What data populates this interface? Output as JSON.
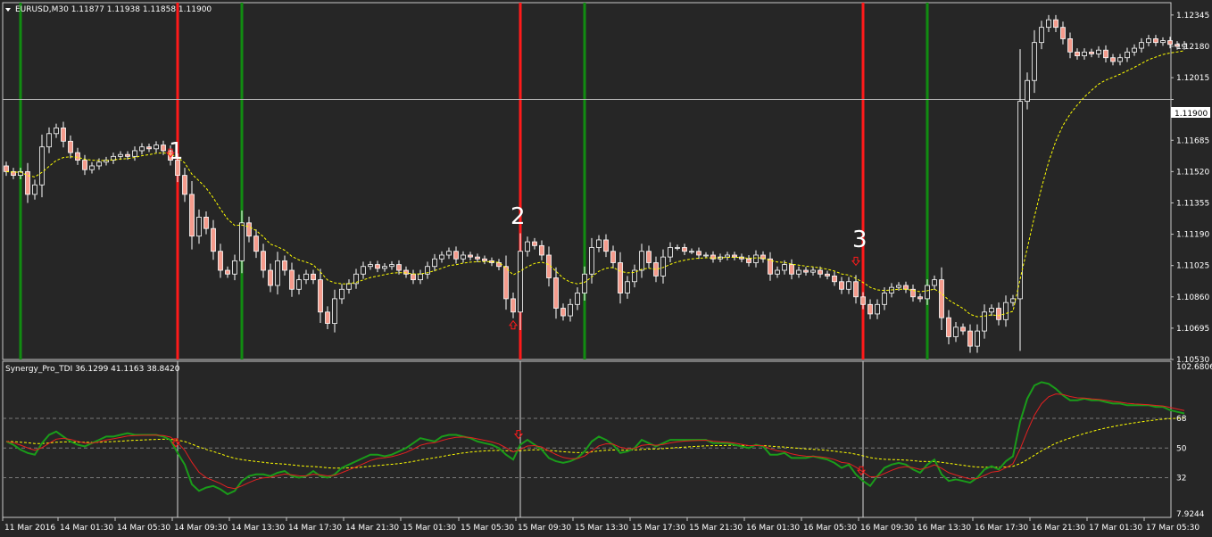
{
  "main_panel": {
    "symbol_header": "EURUSD,M30  1.11877 1.11938 1.11858 1.11900",
    "current_price_label": "1.11900",
    "annotations": [
      "1",
      "2",
      "3"
    ]
  },
  "indicator_panel": {
    "header": "Synergy_Pro_TDI 36.1299 41.1163 38.8420"
  },
  "colors": {
    "background": "#262626",
    "frame": "#c8c8c8",
    "bull_candle": "#ffffff",
    "bear_candle": "#f59b8c",
    "ma": "#ffff00",
    "signal_sell": "#ff1a1a",
    "signal_buy": "#118c11",
    "tdi_green": "#1a9c1a",
    "tdi_red": "#e52020",
    "tdi_yellow": "#ffff00"
  },
  "chart_data": [
    {
      "type": "candlestick",
      "title": "EURUSD,M30",
      "ohlc_header": {
        "open": 1.11877,
        "high": 1.11938,
        "low": 1.11858,
        "close": 1.119
      },
      "ylim": [
        1.1053,
        1.1241
      ],
      "y_ticks": [
        "1.12345",
        "1.12180",
        "1.12015",
        "1.11900",
        "1.11685",
        "1.11520",
        "1.11355",
        "1.11190",
        "1.11025",
        "1.10860",
        "1.10695",
        "1.10530"
      ],
      "y_tick_values": [
        1.12345,
        1.1218,
        1.12015,
        1.119,
        1.11685,
        1.1152,
        1.11355,
        1.1119,
        1.11025,
        1.1086,
        1.10695,
        1.1053
      ],
      "current_price": 1.119,
      "x_ticks": [
        "11 Mar 2016",
        "14 Mar 01:30",
        "14 Mar 05:30",
        "14 Mar 09:30",
        "14 Mar 13:30",
        "14 Mar 17:30",
        "14 Mar 21:30",
        "15 Mar 01:30",
        "15 Mar 05:30",
        "15 Mar 09:30",
        "15 Mar 13:30",
        "15 Mar 17:30",
        "15 Mar 21:30",
        "16 Mar 01:30",
        "16 Mar 05:30",
        "16 Mar 09:30",
        "16 Mar 13:30",
        "16 Mar 17:30",
        "16 Mar 21:30",
        "17 Mar 01:30",
        "17 Mar 05:30"
      ],
      "sell_signal_bars": [
        24,
        72,
        120
      ],
      "buy_signal_bars": [
        2,
        33,
        81,
        129
      ],
      "annotations": [
        {
          "text": "1",
          "bar": 24
        },
        {
          "text": "2",
          "bar": 72
        },
        {
          "text": "3",
          "bar": 120
        }
      ],
      "closes": [
        1.1152,
        1.115,
        1.1152,
        1.114,
        1.1145,
        1.1165,
        1.1172,
        1.1175,
        1.1168,
        1.1162,
        1.1158,
        1.1153,
        1.1155,
        1.1157,
        1.1158,
        1.116,
        1.1161,
        1.116,
        1.1163,
        1.1165,
        1.1164,
        1.1166,
        1.1163,
        1.1158,
        1.115,
        1.114,
        1.1118,
        1.1128,
        1.1122,
        1.111,
        1.11,
        1.1098,
        1.1105,
        1.1125,
        1.1118,
        1.111,
        1.11,
        1.1092,
        1.1105,
        1.11,
        1.109,
        1.1095,
        1.1098,
        1.1095,
        1.1078,
        1.1072,
        1.1085,
        1.109,
        1.1093,
        1.1098,
        1.1102,
        1.1103,
        1.1101,
        1.1102,
        1.1103,
        1.11,
        1.1098,
        1.1095,
        1.1098,
        1.1102,
        1.1106,
        1.1108,
        1.111,
        1.1106,
        1.1108,
        1.1107,
        1.1106,
        1.1105,
        1.1104,
        1.1102,
        1.1085,
        1.1078,
        1.111,
        1.1115,
        1.1113,
        1.1108,
        1.1096,
        1.108,
        1.1076,
        1.1082,
        1.1088,
        1.1098,
        1.1112,
        1.1116,
        1.111,
        1.1104,
        1.1088,
        1.1094,
        1.11,
        1.111,
        1.1104,
        1.1097,
        1.1107,
        1.1112,
        1.1112,
        1.111,
        1.111,
        1.1108,
        1.1108,
        1.1106,
        1.1107,
        1.1108,
        1.1107,
        1.1106,
        1.1104,
        1.1108,
        1.1106,
        1.1098,
        1.11,
        1.1103,
        1.1098,
        1.11,
        1.1099,
        1.11,
        1.1098,
        1.1097,
        1.1094,
        1.109,
        1.1094,
        1.1086,
        1.1082,
        1.1077,
        1.1082,
        1.1088,
        1.1091,
        1.1092,
        1.109,
        1.1086,
        1.1085,
        1.1092,
        1.1095,
        1.1075,
        1.1065,
        1.107,
        1.1068,
        1.106,
        1.1068,
        1.1078,
        1.108,
        1.1074,
        1.1083,
        1.1085,
        1.1189,
        1.12,
        1.122,
        1.1228,
        1.1232,
        1.1228,
        1.1222,
        1.1215,
        1.1213,
        1.1215,
        1.1214,
        1.1216,
        1.1212,
        1.121,
        1.1212,
        1.1215,
        1.1217,
        1.122,
        1.1222,
        1.122,
        1.1221,
        1.1219,
        1.1218,
        1.1219
      ]
    },
    {
      "type": "line",
      "title": "Synergy_Pro_TDI",
      "header_values": [
        36.1299,
        41.1163,
        38.842
      ],
      "ylim": [
        7.9244,
        102.6806
      ],
      "y_ticks": [
        "102.6806",
        "68",
        "50",
        "32",
        "7.9244"
      ],
      "y_tick_values": [
        102.6806,
        68,
        50,
        32,
        7.9244
      ],
      "reference_levels": [
        68,
        50,
        32
      ],
      "signal_marker_bars": [
        24,
        72,
        120
      ],
      "series_colors": [
        "green",
        "red",
        "yellow"
      ],
      "green": [
        54,
        52,
        49,
        47,
        46,
        53,
        58,
        60,
        57,
        54,
        52,
        51,
        53,
        55,
        57,
        57,
        58,
        59,
        58,
        58,
        58,
        58,
        57,
        55,
        47,
        40,
        28,
        24,
        26,
        27,
        25,
        22,
        24,
        30,
        33,
        34,
        34,
        33,
        35,
        36,
        33,
        32,
        33,
        36,
        33,
        32,
        34,
        38,
        40,
        42,
        44,
        46,
        46,
        45,
        46,
        48,
        50,
        53,
        56,
        55,
        54,
        57,
        58,
        58,
        57,
        56,
        54,
        53,
        52,
        50,
        46,
        43,
        52,
        55,
        52,
        49,
        44,
        42,
        41,
        42,
        44,
        48,
        54,
        57,
        55,
        52,
        47,
        48,
        50,
        55,
        53,
        51,
        53,
        55,
        55,
        55,
        55,
        55,
        55,
        53,
        53,
        53,
        52,
        51,
        50,
        52,
        51,
        46,
        46,
        47,
        44,
        44,
        44,
        45,
        44,
        43,
        41,
        38,
        40,
        34,
        30,
        27,
        33,
        38,
        40,
        41,
        40,
        37,
        35,
        40,
        43,
        34,
        30,
        31,
        30,
        29,
        32,
        37,
        39,
        37,
        42,
        45,
        66,
        80,
        88,
        90,
        89,
        86,
        82,
        79,
        79,
        80,
        79,
        79,
        78,
        77,
        77,
        76,
        76,
        76,
        76,
        75,
        75,
        73,
        72,
        71
      ]
    }
  ]
}
